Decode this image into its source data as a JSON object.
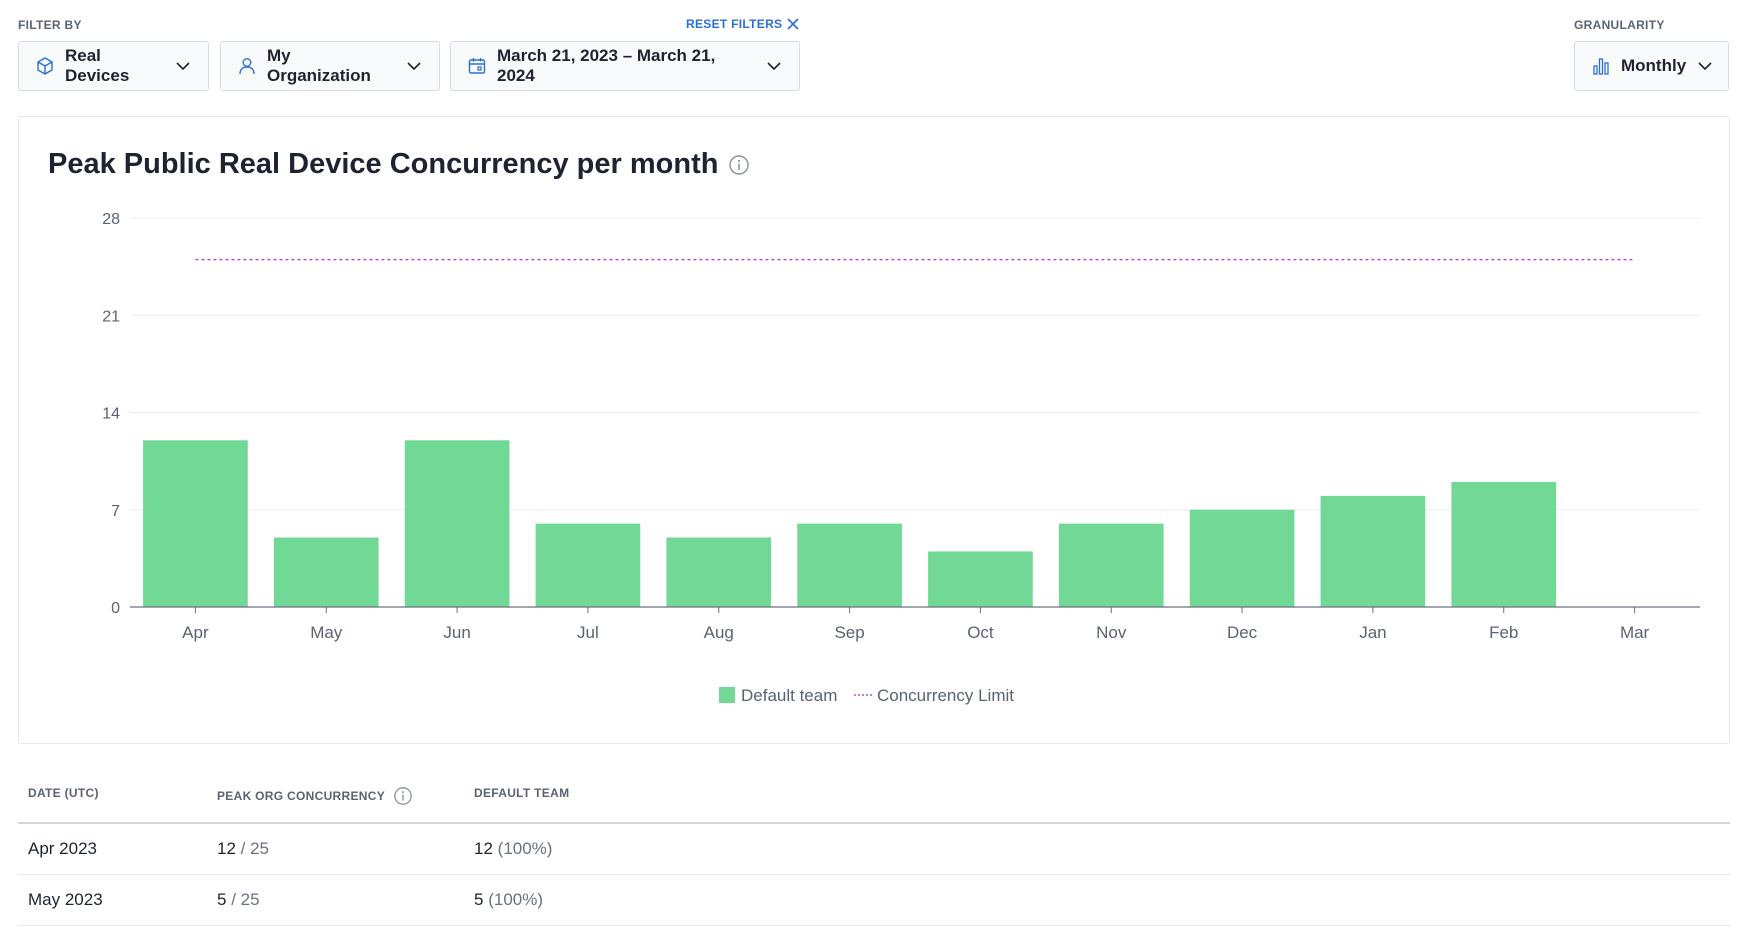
{
  "filters": {
    "label": "FILTER BY",
    "reset_label": "RESET FILTERS",
    "device": "Real Devices",
    "organization": "My Organization",
    "date_range": "March 21, 2023 – March 21, 2024"
  },
  "granularity": {
    "label": "GRANULARITY",
    "value": "Monthly"
  },
  "chart": {
    "title": "Peak Public Real Device Concurrency per month"
  },
  "chart_data": {
    "type": "bar",
    "categories": [
      "Apr",
      "May",
      "Jun",
      "Jul",
      "Aug",
      "Sep",
      "Oct",
      "Nov",
      "Dec",
      "Jan",
      "Feb",
      "Mar"
    ],
    "series": [
      {
        "name": "Default team",
        "values": [
          12,
          5,
          12,
          6,
          5,
          6,
          4,
          6,
          7,
          8,
          9,
          0
        ],
        "color": "#72d896"
      }
    ],
    "reference_line": {
      "name": "Concurrency Limit",
      "value": 25,
      "color": "#c24ad8",
      "style": "dotted"
    },
    "yticks": [
      0,
      7,
      14,
      21,
      28
    ],
    "ylim": [
      0,
      28
    ],
    "grid": true,
    "legend_position": "bottom-center"
  },
  "table": {
    "headers": [
      "DATE (UTC)",
      "PEAK ORG CONCURRENCY",
      "DEFAULT TEAM"
    ],
    "rows": [
      {
        "date": "Apr 2023",
        "peak": "12",
        "limit": "/ 25",
        "team": "12",
        "team_pct": "(100%)"
      },
      {
        "date": "May 2023",
        "peak": "5",
        "limit": "/ 25",
        "team": "5",
        "team_pct": "(100%)"
      }
    ]
  },
  "colors": {
    "accent": "#2b6fd6",
    "bar": "#72d896",
    "limit_line": "#c24ad8"
  },
  "icons": [
    "cube-icon",
    "user-icon",
    "calendar-icon",
    "bar-chart-icon",
    "chevron-down-icon",
    "close-icon",
    "info-icon"
  ]
}
